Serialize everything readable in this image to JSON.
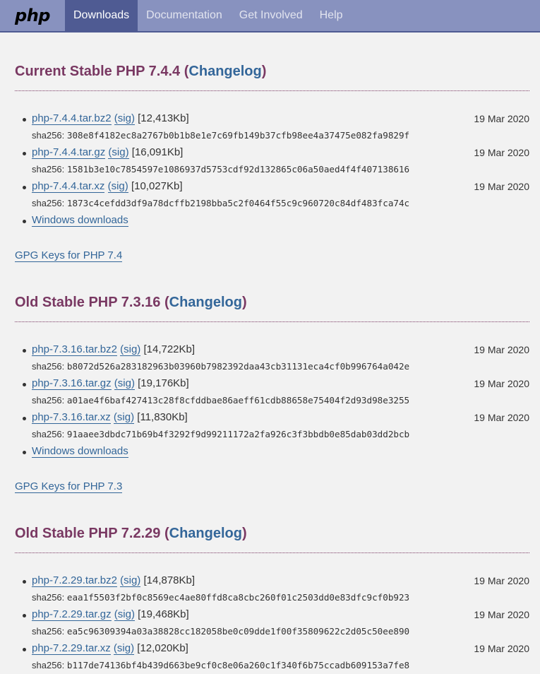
{
  "nav": {
    "logo": "php",
    "items": [
      "Downloads",
      "Documentation",
      "Get Involved",
      "Help"
    ]
  },
  "colors": {
    "nav_bg": "#8892bf",
    "nav_active": "#4f5b93",
    "title": "#793862",
    "link": "#336699"
  },
  "releases": [
    {
      "title_prefix": "Current Stable PHP 7.4.4",
      "changelog": "Changelog",
      "files": [
        {
          "name": "php-7.4.4.tar.bz2",
          "sig": "sig",
          "size": "[12,413Kb]",
          "date": "19 Mar 2020",
          "sha_label": "sha256:",
          "sha": "308e8f4182ec8a2767b0b1b8e1e7c69fb149b37cfb98ee4a37475e082fa9829f"
        },
        {
          "name": "php-7.4.4.tar.gz",
          "sig": "sig",
          "size": "[16,091Kb]",
          "date": "19 Mar 2020",
          "sha_label": "sha256:",
          "sha": "1581b3e10c7854597e1086937d5753cdf92d132865c06a50aed4f4f407138616"
        },
        {
          "name": "php-7.4.4.tar.xz",
          "sig": "sig",
          "size": "[10,027Kb]",
          "date": "19 Mar 2020",
          "sha_label": "sha256:",
          "sha": "1873c4cefdd3df9a78dcffb2198bba5c2f0464f55c9c960720c84df483fca74c"
        }
      ],
      "windows": "Windows downloads",
      "gpg": "GPG Keys for PHP 7.4"
    },
    {
      "title_prefix": "Old Stable PHP 7.3.16",
      "changelog": "Changelog",
      "files": [
        {
          "name": "php-7.3.16.tar.bz2",
          "sig": "sig",
          "size": "[14,722Kb]",
          "date": "19 Mar 2020",
          "sha_label": "sha256:",
          "sha": "b8072d526a283182963b03960b7982392daa43cb31131eca4cf0b996764a042e"
        },
        {
          "name": "php-7.3.16.tar.gz",
          "sig": "sig",
          "size": "[19,176Kb]",
          "date": "19 Mar 2020",
          "sha_label": "sha256:",
          "sha": "a01ae4f6baf427413c28f8cfddbae86aeff61cdb88658e75404f2d93d98e3255"
        },
        {
          "name": "php-7.3.16.tar.xz",
          "sig": "sig",
          "size": "[11,830Kb]",
          "date": "19 Mar 2020",
          "sha_label": "sha256:",
          "sha": "91aaee3dbdc71b69b4f3292f9d99211172a2fa926c3f3bbdb0e85dab03dd2bcb"
        }
      ],
      "windows": "Windows downloads",
      "gpg": "GPG Keys for PHP 7.3"
    },
    {
      "title_prefix": "Old Stable PHP 7.2.29",
      "changelog": "Changelog",
      "files": [
        {
          "name": "php-7.2.29.tar.bz2",
          "sig": "sig",
          "size": "[14,878Kb]",
          "date": "19 Mar 2020",
          "sha_label": "sha256:",
          "sha": "eaa1f5503f2bf0c8569ec4ae80ffd8ca8cbc260f01c2503dd0e83dfc9cf0b923"
        },
        {
          "name": "php-7.2.29.tar.gz",
          "sig": "sig",
          "size": "[19,468Kb]",
          "date": "19 Mar 2020",
          "sha_label": "sha256:",
          "sha": "ea5c96309394a03a38828cc182058be0c09dde1f00f35809622c2d05c50ee890"
        },
        {
          "name": "php-7.2.29.tar.xz",
          "sig": "sig",
          "size": "[12,020Kb]",
          "date": "19 Mar 2020",
          "sha_label": "sha256:",
          "sha": "b117de74136bf4b439d663be9cf0c8e06a260c1f340f6b75ccadb609153a7fe8"
        }
      ]
    }
  ]
}
